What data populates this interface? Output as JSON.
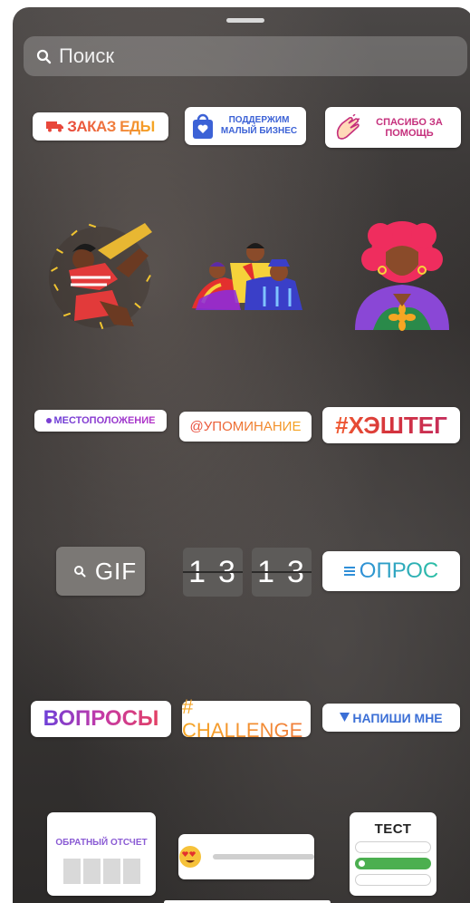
{
  "search": {
    "placeholder": "Поиск"
  },
  "stickers": {
    "food_order": "ЗАКАЗ ЕДЫ",
    "support_small_business": "ПОДДЕРЖИМ МАЛЫЙ БИЗНЕС",
    "thanks_for_help": "СПАСИБО ЗА ПОМОЩЬ",
    "location": "МЕСТОПОЛОЖЕНИЕ",
    "mention": "@УПОМИНАНИЕ",
    "hashtag": "#ХЭШТЕГ",
    "gif": "GIF",
    "timer_left": "13",
    "timer_right": "13",
    "poll": "ОПРОС",
    "questions": "ВОПРОСЫ",
    "challenge": "# CHALLENGE",
    "write_me": "НАПИШИ МНЕ",
    "countdown": "ОБРАТНЫЙ ОТСЧЕТ",
    "quiz": "ТЕСТ"
  },
  "icons": {
    "search": "search-icon",
    "truck": "truck-icon",
    "bag": "shopping-bag-heart-icon",
    "hands": "clapping-hands-icon",
    "emoji": "heart-eyes-emoji-icon"
  },
  "colors": {
    "background": "#3a3736",
    "quiz_correct": "#4caf50"
  }
}
